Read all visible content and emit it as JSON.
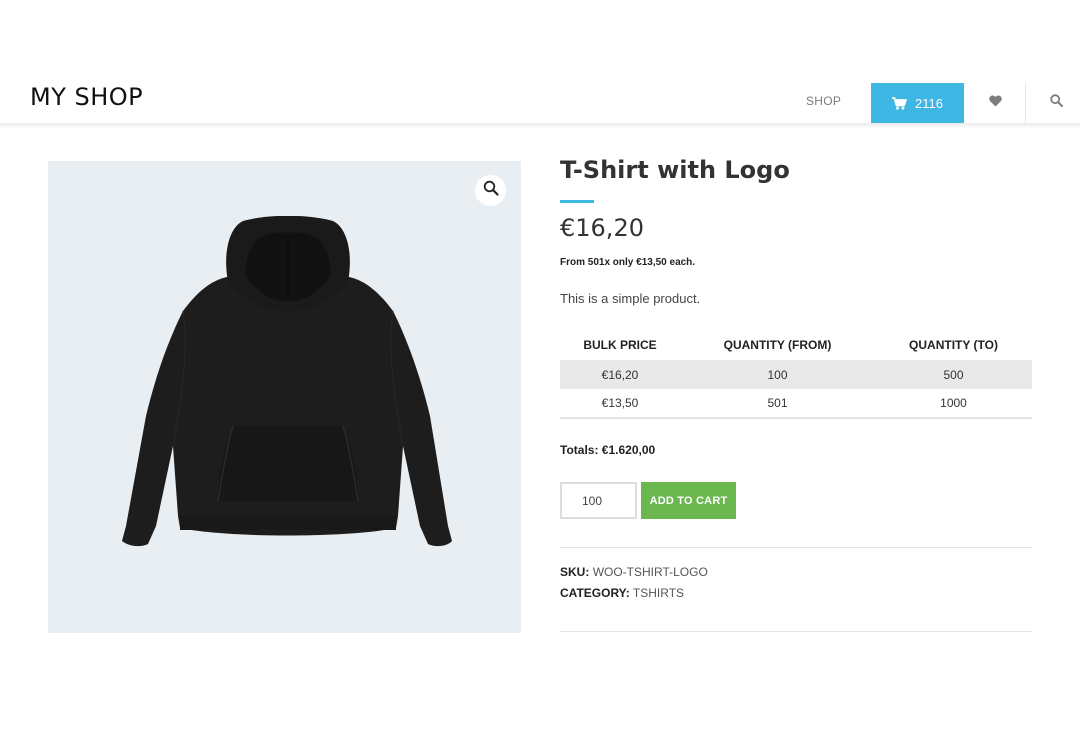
{
  "header": {
    "logo": "MY SHOP",
    "nav_shop": "SHOP",
    "cart_count": "2116",
    "colors": {
      "accent": "#3fb7e4"
    }
  },
  "product": {
    "title": "T-Shirt with Logo",
    "price": "€16,20",
    "bulk_note": "From 501x only €13,50 each.",
    "description": "This is a simple product."
  },
  "bulk_table": {
    "headers": [
      "BULK PRICE",
      "QUANTITY (FROM)",
      "QUANTITY (TO)"
    ],
    "rows": [
      [
        "€16,20",
        "100",
        "500"
      ],
      [
        "€13,50",
        "501",
        "1000"
      ]
    ]
  },
  "totals": {
    "label": "Totals:",
    "value": "€1.620,00"
  },
  "cart_form": {
    "quantity": "100",
    "add_to_cart_label": "ADD TO CART",
    "button_color": "#6ab74f"
  },
  "meta": {
    "sku_label": "SKU:",
    "sku_value": "WOO-TSHIRT-LOGO",
    "category_label": "CATEGORY:",
    "category_value": "TSHIRTS"
  },
  "icons": {
    "cart": "cart-icon",
    "heart": "heart-icon",
    "search": "search-icon",
    "zoom": "zoom-icon"
  }
}
